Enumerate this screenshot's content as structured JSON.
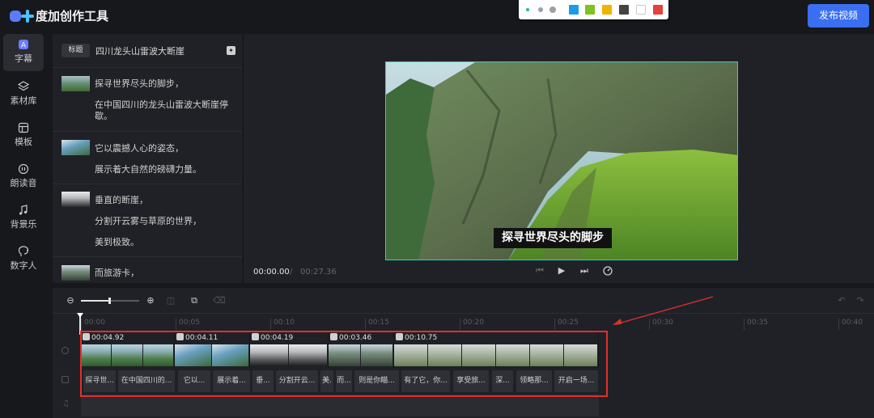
{
  "app": {
    "title": "度加创作工具",
    "publish_label": "发布视频"
  },
  "toolbar": {
    "dots": [
      "#22b8a0",
      "#9aa0a6",
      "#9aa0a6"
    ],
    "colors": [
      "#1c9be6",
      "#7dc21e",
      "#f0b400",
      "#444444",
      "#ffffff",
      "#e8403a"
    ]
  },
  "sidebar": {
    "items": [
      {
        "label": "字幕",
        "icon": "subtitle-icon",
        "active": true
      },
      {
        "label": "素材库",
        "icon": "layers-icon"
      },
      {
        "label": "模板",
        "icon": "template-icon"
      },
      {
        "label": "朗读音",
        "icon": "voice-icon"
      },
      {
        "label": "背景乐",
        "icon": "music-icon"
      },
      {
        "label": "数字人",
        "icon": "avatar-icon"
      }
    ]
  },
  "captions": {
    "title_tag": "标题",
    "title": "四川龙头山雷波大断崖",
    "segments": [
      {
        "lines": [
          "探寻世界尽头的脚步，",
          "在中国四川的龙头山雷波大断崖停歇。"
        ]
      },
      {
        "lines": [
          "它以震撼人心的姿态，",
          "展示着大自然的磅礴力量。"
        ]
      },
      {
        "lines": [
          "垂直的断崖，",
          "分割开云雾与草原的世界，",
          "美到极致。"
        ]
      },
      {
        "lines": [
          "而旅游卡，"
        ]
      }
    ]
  },
  "preview": {
    "subtitle": "探寻世界尽头的脚步",
    "current_time": "00:00.00",
    "separator": "/",
    "total_time": "00:27.36"
  },
  "timeline": {
    "ruler": [
      "00:00",
      "00:05",
      "00:10",
      "00:15",
      "00:20",
      "00:25",
      "00:30",
      "00:35",
      "00:40"
    ],
    "clips": [
      {
        "duration": "00:04.92"
      },
      {
        "duration": "00:04.11"
      },
      {
        "duration": "00:04.19"
      },
      {
        "duration": "00:03.46"
      },
      {
        "duration": "00:10.75"
      }
    ],
    "text_clips": [
      "探寻世...",
      "在中国四川的...",
      "它以...",
      "展示着...",
      "垂...",
      "分割开云...",
      "美.",
      "而...",
      "则是你瞄...",
      "有了它，你...",
      "享受旅...",
      "深...",
      "领略那...",
      "开启一场..."
    ]
  }
}
